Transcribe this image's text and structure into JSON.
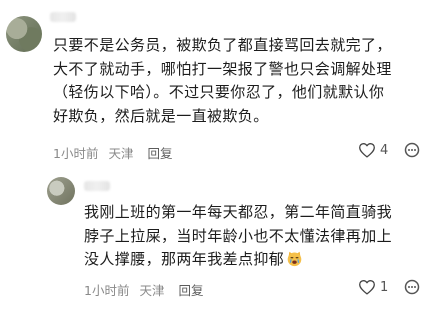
{
  "comments": [
    {
      "lines": [
        "只要不是公务员，被欺负了都直接骂回去就完了，",
        "大不了就动手，哪怕打一架报了警也只会调解处理",
        "（轻伤以下哈）。不过只要你忍了，他们就默认你",
        "好欺负，然后就是一直被欺负。"
      ],
      "time": "1小时前",
      "location": "天津",
      "reply_label": "回复",
      "likes": "4"
    },
    {
      "lines": [
        "我刚上班的第一年每天都忍，第二年简直骑我",
        "脖子上拉屎，当时年龄小也不太懂法律再加上",
        "没人撑腰，那两年我差点抑郁"
      ],
      "time": "1小时前",
      "location": "天津",
      "reply_label": "回复",
      "likes": "1"
    }
  ]
}
